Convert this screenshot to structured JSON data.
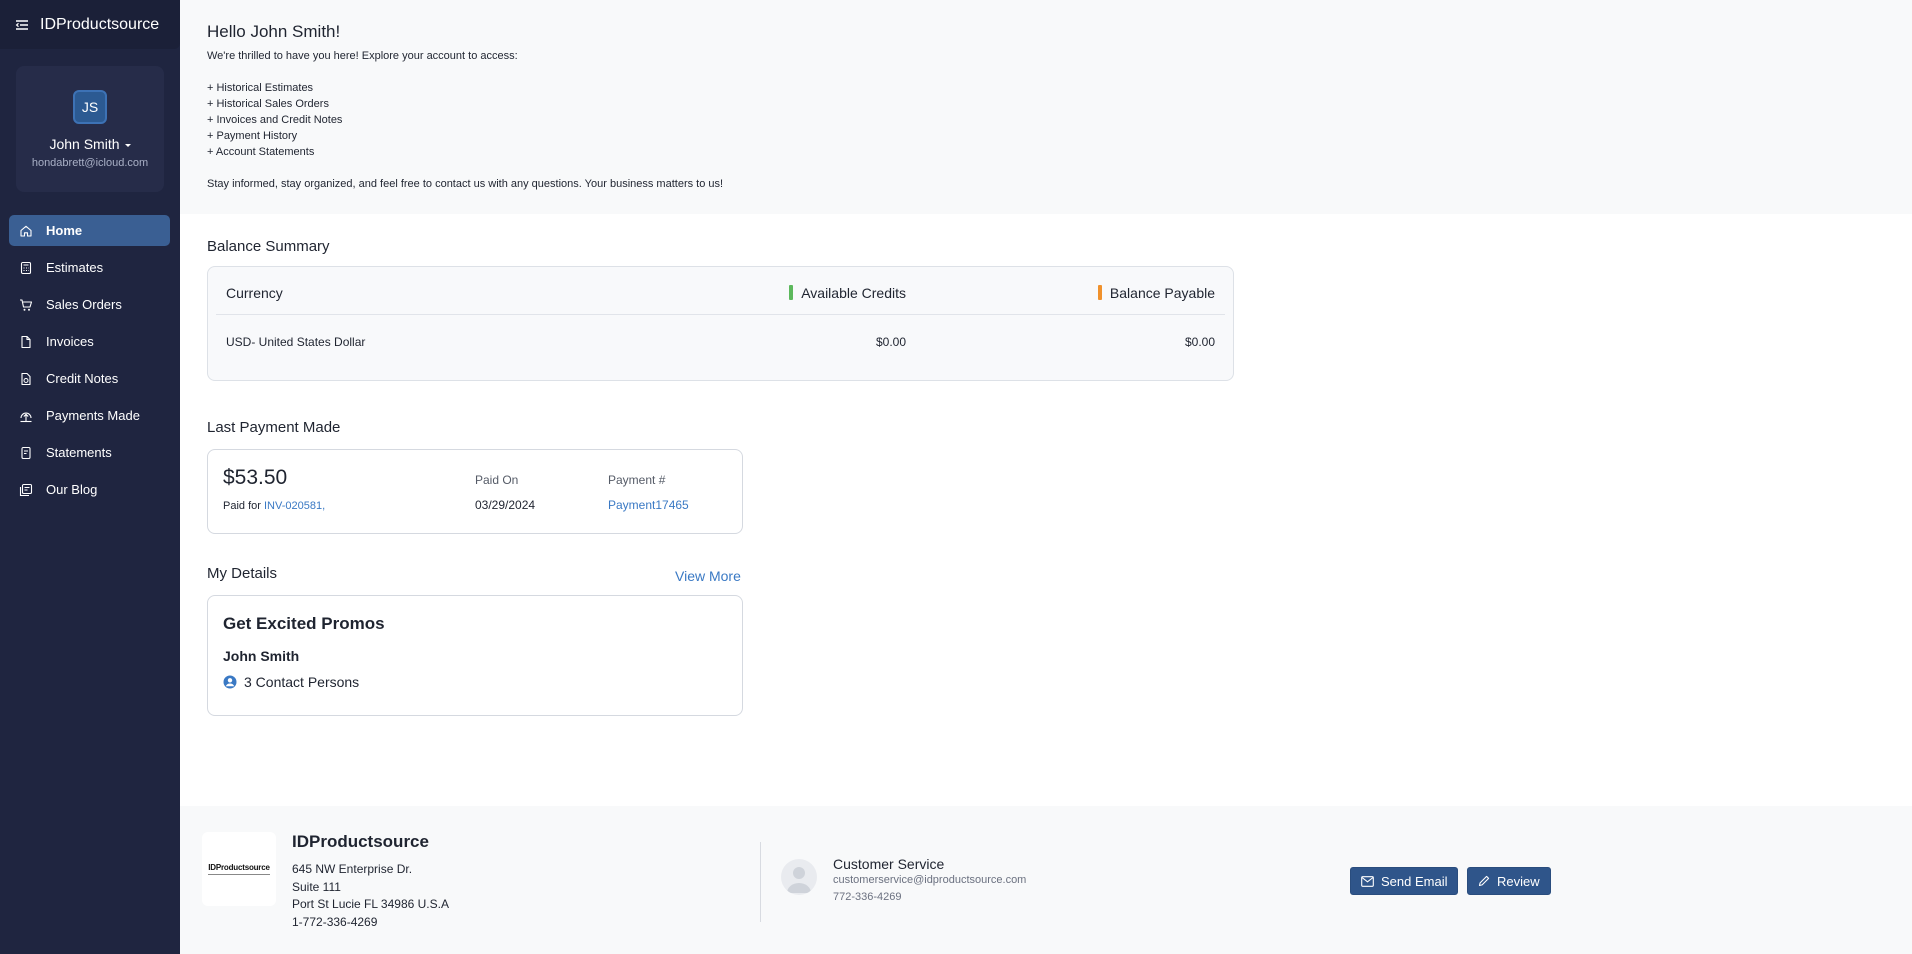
{
  "app": {
    "brand": "IDProductsource"
  },
  "profile": {
    "initials": "JS",
    "name": "John Smith",
    "email": "hondabrett@icloud.com"
  },
  "nav": {
    "items": [
      {
        "label": "Home",
        "icon": "home-icon",
        "active": true
      },
      {
        "label": "Estimates",
        "icon": "calculator-icon",
        "active": false
      },
      {
        "label": "Sales Orders",
        "icon": "cart-icon",
        "active": false
      },
      {
        "label": "Invoices",
        "icon": "document-icon",
        "active": false
      },
      {
        "label": "Credit Notes",
        "icon": "credit-note-icon",
        "active": false
      },
      {
        "label": "Payments Made",
        "icon": "upload-circle-icon",
        "active": false
      },
      {
        "label": "Statements",
        "icon": "statement-icon",
        "active": false
      },
      {
        "label": "Our Blog",
        "icon": "blog-icon",
        "active": false
      }
    ]
  },
  "welcome": {
    "greeting": "Hello John Smith!",
    "intro": "We're thrilled to have you here! Explore your account to access:",
    "list": [
      "+ Historical Estimates",
      "+ Historical Sales Orders",
      "+ Invoices and Credit Notes",
      "+ Payment History",
      "+ Account Statements"
    ],
    "outro": "Stay informed, stay organized, and feel free to contact us with any questions. Your business matters to us!"
  },
  "balance": {
    "title": "Balance Summary",
    "headers": {
      "currency": "Currency",
      "credits": "Available Credits",
      "payable": "Balance Payable"
    },
    "row": {
      "currency": "USD- United States Dollar",
      "credits": "$0.00",
      "payable": "$0.00"
    },
    "colors": {
      "credits_marker": "#5cb85c",
      "payable_marker": "#f0912c"
    }
  },
  "last_payment": {
    "title": "Last Payment Made",
    "amount": "$53.50",
    "paid_for_label": "Paid for",
    "paid_for_invoice": "INV-020581,",
    "paid_on_label": "Paid On",
    "paid_on": "03/29/2024",
    "payment_no_label": "Payment #",
    "payment_no": "Payment17465"
  },
  "details": {
    "title": "My Details",
    "view_more": "View More",
    "company": "Get Excited Promos",
    "name": "John Smith",
    "contacts": "3 Contact Persons"
  },
  "footer": {
    "logo_text": "IDProductsource",
    "company": "IDProductsource",
    "address": [
      "645 NW Enterprise Dr.",
      "Suite 111",
      "Port St Lucie FL 34986 U.S.A",
      "1-772-336-4269"
    ],
    "cs_title": "Customer Service",
    "cs_email": "customerservice@idproductsource.com",
    "cs_phone": "772-336-4269",
    "send_email": "Send Email",
    "review": "Review"
  }
}
